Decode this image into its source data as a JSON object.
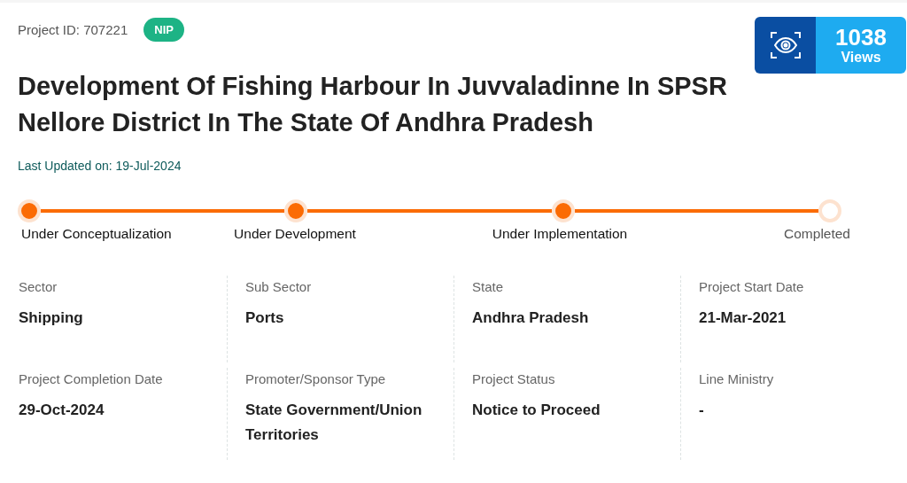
{
  "project_id": "Project ID: 707221",
  "badge": "NIP",
  "views": {
    "count": "1038",
    "label": "Views"
  },
  "title": "Development Of Fishing Harbour In Juvvaladinne In SPSR Nellore District In The State Of Andhra Pradesh",
  "last_updated": "Last Updated on: 19-Jul-2024",
  "stages": [
    {
      "label": "Under Conceptualization",
      "done": true
    },
    {
      "label": "Under Development",
      "done": true
    },
    {
      "label": "Under Implementation",
      "done": true
    },
    {
      "label": "Completed",
      "done": false
    }
  ],
  "details": [
    {
      "label": "Sector",
      "value": "Shipping"
    },
    {
      "label": "Sub Sector",
      "value": "Ports"
    },
    {
      "label": "State",
      "value": "Andhra Pradesh"
    },
    {
      "label": "Project Start Date",
      "value": "21-Mar-2021"
    },
    {
      "label": "Project Completion Date",
      "value": "29-Oct-2024"
    },
    {
      "label": "Promoter/Sponsor Type",
      "value": "State Government/Union Territories"
    },
    {
      "label": "Project Status",
      "value": "Notice to Proceed"
    },
    {
      "label": "Line Ministry",
      "value": "-"
    }
  ]
}
